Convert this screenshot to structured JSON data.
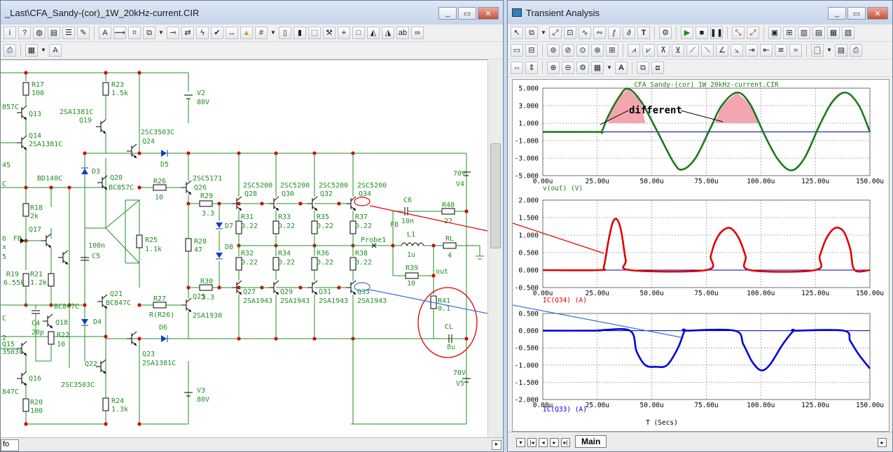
{
  "left_window": {
    "title": "_Last\\CFA_Sandy-(cor)_1W_20kHz-current.CIR",
    "info_tab": "fo"
  },
  "right_window": {
    "title": "Transient Analysis",
    "tab_main": "Main"
  },
  "circuit": {
    "components": [
      {
        "ref": "R17",
        "val": "100"
      },
      {
        "ref": "R23",
        "val": "1.5k"
      },
      {
        "ref": "V2",
        "val": "80V"
      },
      {
        "ref": "Q13",
        "val": ""
      },
      {
        "ref": "Q19",
        "val": "2SA1381C"
      },
      {
        "ref": "Q14",
        "val": "2SA1381C"
      },
      {
        "ref": "Q24",
        "val": "2SC3503C"
      },
      {
        "ref": "D5",
        "val": ""
      },
      {
        "ref": "D3",
        "val": ""
      },
      {
        "ref": "Q20",
        "val": "BC857C"
      },
      {
        "ref": "R26",
        "val": "10"
      },
      {
        "ref": "Q26",
        "val": "2SC5171"
      },
      {
        "ref": "R29",
        "val": "3.3"
      },
      {
        "ref": "R28",
        "val": "47"
      },
      {
        "ref": "R25",
        "val": "1.1k"
      },
      {
        "ref": "C5",
        "val": "100n"
      },
      {
        "ref": "D7",
        "val": ""
      },
      {
        "ref": "D8",
        "val": ""
      },
      {
        "ref": "R18",
        "val": "2k"
      },
      {
        "ref": "Q17",
        "val": ""
      },
      {
        "ref": "R19",
        "val": "6.55k"
      },
      {
        "ref": "R21",
        "val": "1.2k"
      },
      {
        "ref": "Q18",
        "val": "BC847C"
      },
      {
        "ref": "C4",
        "val": "20p"
      },
      {
        "ref": "R22",
        "val": "10"
      },
      {
        "ref": "Q21",
        "val": "BC847C"
      },
      {
        "ref": "D4",
        "val": ""
      },
      {
        "ref": "R27",
        "val": "R(R26)"
      },
      {
        "ref": "Q25",
        "val": "2SA1930"
      },
      {
        "ref": "R30",
        "val": "3.3"
      },
      {
        "ref": "D6",
        "val": ""
      },
      {
        "ref": "Q23",
        "val": "2SA1381C"
      },
      {
        "ref": "Q22",
        "val": "2SC3503C"
      },
      {
        "ref": "R24",
        "val": "1.3k"
      },
      {
        "ref": "V3",
        "val": "80V"
      },
      {
        "ref": "Q15",
        "val": ""
      },
      {
        "ref": "Q16",
        "val": ""
      },
      {
        "ref": "R20",
        "val": "100"
      },
      {
        "ref": "Q28",
        "val": "2SC5200"
      },
      {
        "ref": "Q30",
        "val": "2SC5200"
      },
      {
        "ref": "Q32",
        "val": "2SC5200"
      },
      {
        "ref": "Q34",
        "val": "2SC5200"
      },
      {
        "ref": "R31",
        "val": "0.22"
      },
      {
        "ref": "R33",
        "val": "0.22"
      },
      {
        "ref": "R35",
        "val": "0.22"
      },
      {
        "ref": "R37",
        "val": "0.22"
      },
      {
        "ref": "R32",
        "val": "0.22"
      },
      {
        "ref": "R34",
        "val": "0.22"
      },
      {
        "ref": "R36",
        "val": "0.22"
      },
      {
        "ref": "R38",
        "val": "0.22"
      },
      {
        "ref": "Q27",
        "val": "2SA1943"
      },
      {
        "ref": "Q29",
        "val": "2SA1943"
      },
      {
        "ref": "Q31",
        "val": "2SA1943"
      },
      {
        "ref": "Q33",
        "val": "2SA1943"
      },
      {
        "ref": "C6",
        "val": "10n"
      },
      {
        "ref": "R40",
        "val": "22"
      },
      {
        "ref": "L1",
        "val": "1u"
      },
      {
        "ref": "RL",
        "val": "4"
      },
      {
        "ref": "R39",
        "val": "10"
      },
      {
        "ref": "R41",
        "val": "0.1"
      },
      {
        "ref": "CL",
        "val": "8u"
      },
      {
        "ref": "V4",
        "val": "70V"
      },
      {
        "ref": "V5",
        "val": "70V"
      }
    ],
    "labels": {
      "fb1": "FB",
      "fb2": "FB",
      "probe": "Probe1",
      "out": "out",
      "bd140": "BD140C",
      "v857": "857C",
      "v45": "45",
      "v6": "6",
      "c3503": "3503C",
      "c847": "847C",
      "cC": "C",
      "c5": "5",
      "x": "x",
      "c2": "2"
    }
  },
  "plots": {
    "title": "CFA_Sandy-(cor)_1W_20kHz-current.CIR",
    "x_axis_title": "T (Secs)",
    "x_ticks": [
      "0.00u",
      "25.00u",
      "50.00u",
      "75.00u",
      "100.00u",
      "125.00u",
      "150.00u"
    ],
    "annotation": "different",
    "panels": [
      {
        "label": "v(out) (V)",
        "color": "#1a7a1a",
        "y_ticks": [
          "5.000",
          "3.000",
          "1.000",
          "-1.000",
          "-3.000",
          "-5.000"
        ]
      },
      {
        "label": "IC(Q34) (A)",
        "color": "#e00000",
        "y_ticks": [
          "2.000",
          "1.500",
          "1.000",
          "0.500",
          "0.000",
          "-0.500"
        ]
      },
      {
        "label": "IC(Q33) (A)",
        "color": "#0000dd",
        "y_ticks": [
          "0.500",
          "0.000",
          "-0.500",
          "-1.000",
          "-1.500",
          "-2.000"
        ]
      }
    ]
  },
  "chart_data": [
    {
      "type": "line",
      "title": "CFA_Sandy-(cor)_1W_20kHz-current.CIR",
      "xlabel": "T (Secs)",
      "ylabel": "v(out) (V)",
      "xlim": [
        0,
        150
      ],
      "ylim": [
        -5,
        5
      ],
      "x_unit": "us",
      "series": [
        {
          "name": "v(out)",
          "x": [
            0,
            25,
            27,
            30,
            35,
            39,
            45,
            52,
            60,
            64,
            70,
            77,
            82,
            89,
            95,
            102,
            108,
            114,
            120,
            127,
            133,
            139,
            145,
            150
          ],
          "values": [
            0,
            0,
            0.05,
            1.8,
            4.0,
            4.95,
            3.5,
            0.3,
            -3.5,
            -4.3,
            -3,
            0.5,
            3,
            4.5,
            3.2,
            -0.5,
            -3.2,
            -4.4,
            -3,
            0.8,
            3.5,
            4.5,
            3,
            0
          ]
        }
      ]
    },
    {
      "type": "line",
      "xlabel": "",
      "ylabel": "IC(Q34) (A)",
      "xlim": [
        0,
        150
      ],
      "ylim": [
        -0.5,
        2
      ],
      "x_unit": "us",
      "series": [
        {
          "name": "IC(Q34)",
          "x": [
            0,
            26,
            28,
            30,
            32,
            34,
            36,
            38,
            40,
            75,
            77,
            79,
            82,
            86,
            90,
            93,
            95,
            125,
            127,
            130,
            134,
            138,
            141,
            143,
            150
          ],
          "values": [
            0,
            0,
            0.1,
            0.8,
            1.35,
            1.45,
            1.1,
            0.3,
            0,
            0,
            0.4,
            0.8,
            1.1,
            1.2,
            0.9,
            0.4,
            0,
            0,
            0.4,
            0.9,
            1.2,
            1.1,
            0.6,
            0,
            0
          ]
        }
      ]
    },
    {
      "type": "line",
      "xlabel": "",
      "ylabel": "IC(Q33) (A)",
      "xlim": [
        0,
        150
      ],
      "ylim": [
        -2,
        0.5
      ],
      "x_unit": "us",
      "series": [
        {
          "name": "IC(Q33)",
          "x": [
            0,
            25,
            26,
            40,
            43,
            47,
            52,
            57,
            62,
            65,
            66,
            88,
            92,
            96,
            100,
            104,
            110,
            115,
            116,
            138,
            141,
            145,
            150
          ],
          "values": [
            0,
            0,
            0.01,
            0,
            -0.6,
            -1.0,
            -1.05,
            -1.0,
            -0.5,
            0,
            0,
            0,
            -0.4,
            -0.9,
            -1.15,
            -1.0,
            -0.4,
            0,
            0,
            0,
            -0.3,
            -0.7,
            -1.1
          ]
        }
      ]
    }
  ]
}
